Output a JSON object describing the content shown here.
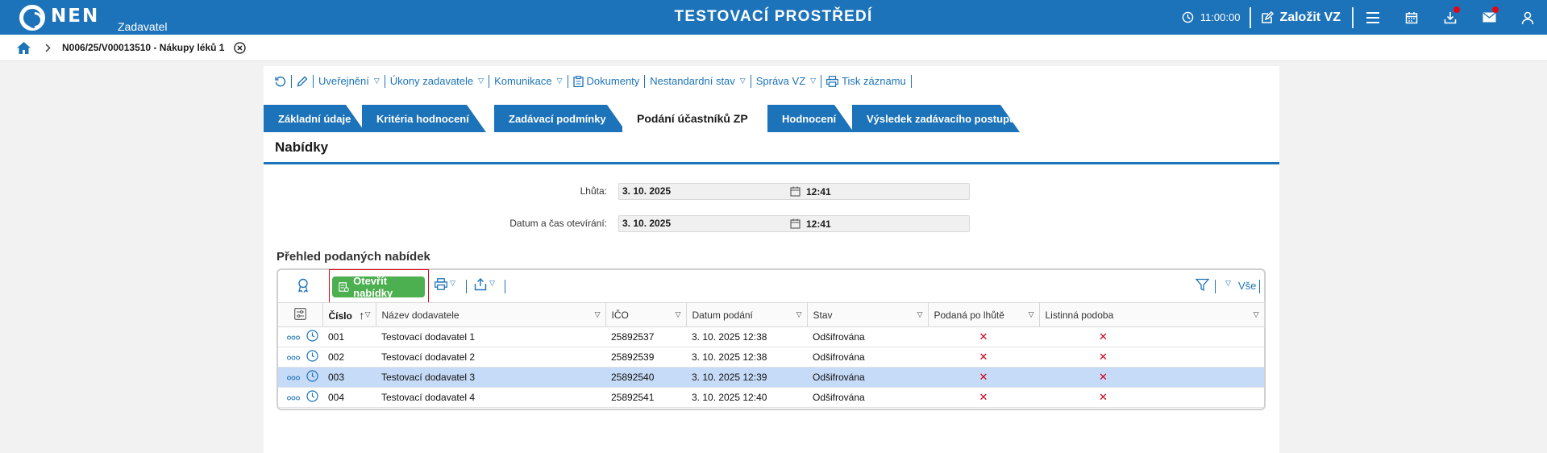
{
  "header": {
    "logo_text": "NEN",
    "logo_sub": "Zadavatel",
    "title": "TESTOVACÍ PROSTŘEDÍ",
    "time": "11:00:00",
    "create_label": "Založit VZ"
  },
  "breadcrumb": {
    "label": "N006/25/V00013510 - Nákupy léků 1"
  },
  "toolbar": {
    "items": [
      {
        "label": "Uveřejnění"
      },
      {
        "label": "Úkony zadavatele"
      },
      {
        "label": "Komunikace"
      },
      {
        "label": "Dokumenty"
      },
      {
        "label": "Nestandardní stav"
      },
      {
        "label": "Správa VZ"
      },
      {
        "label": "Tisk záznamu"
      }
    ]
  },
  "tabs": [
    {
      "label": "Základní údaje"
    },
    {
      "label": "Kritéria hodnocení"
    },
    {
      "label": "Zadávací podmínky"
    },
    {
      "label": "Podání účastníků ZP"
    },
    {
      "label": "Hodnocení"
    },
    {
      "label": "Výsledek zadávacího postupu"
    }
  ],
  "section": {
    "title": "Nabídky"
  },
  "form": {
    "deadline_label": "Lhůta:",
    "deadline_date": "3. 10. 2025",
    "deadline_time": "12:41",
    "opening_label": "Datum a čas otevírání:",
    "opening_date": "3. 10. 2025",
    "opening_time": "12:41"
  },
  "grid": {
    "title": "Přehled podaných nabídek",
    "open_button": "Otevřít nabídky",
    "filter_all": "Vše",
    "columns": [
      "Číslo",
      "Název dodavatele",
      "IČO",
      "Datum podání",
      "Stav",
      "Podaná po lhůtě",
      "Listinná podoba"
    ],
    "rows": [
      {
        "cislo": "001",
        "nazev": "Testovací dodavatel 1",
        "ico": "25892537",
        "datum": "3. 10. 2025 12:38",
        "stav": "Odšifrována",
        "po_lhute": "✕",
        "listinna": "✕"
      },
      {
        "cislo": "002",
        "nazev": "Testovací dodavatel 2",
        "ico": "25892539",
        "datum": "3. 10. 2025 12:38",
        "stav": "Odšifrována",
        "po_lhute": "✕",
        "listinna": "✕"
      },
      {
        "cislo": "003",
        "nazev": "Testovací dodavatel 3",
        "ico": "25892540",
        "datum": "3. 10. 2025 12:39",
        "stav": "Odšifrována",
        "po_lhute": "✕",
        "listinna": "✕"
      },
      {
        "cislo": "004",
        "nazev": "Testovací dodavatel 4",
        "ico": "25892541",
        "datum": "3. 10. 2025 12:40",
        "stav": "Odšifrována",
        "po_lhute": "✕",
        "listinna": "✕"
      }
    ]
  },
  "colors": {
    "brand": "#1d73b9",
    "button_green": "#4caf50",
    "selected_row": "#c6dbf7",
    "error_red": "#d0021b"
  },
  "icons": {
    "refresh": "refresh-icon",
    "edit": "pencil-icon",
    "documents": "clipboard-icon",
    "print": "printer-icon",
    "filter": "funnel-icon"
  }
}
